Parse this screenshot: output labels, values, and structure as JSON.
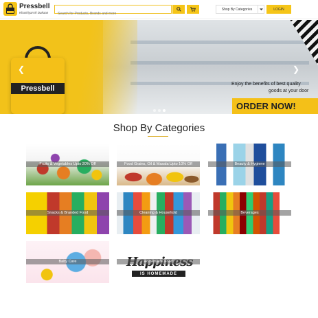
{
  "header": {
    "brand": "Pressbell",
    "tagline": "Khushiyan ki Dukaan",
    "search_placeholder": "Search for Products, Brands and more",
    "category_select": "Shop By Categories",
    "login_label": "LOGIN"
  },
  "banner": {
    "bag_label": "Pressbell",
    "tagline_line1": "Enjoy the benefits of best quality",
    "tagline_line2": "goods at your door",
    "order_label": "ORDER NOW!"
  },
  "section": {
    "title": "Shop By Categories"
  },
  "categories": [
    {
      "label": "Fruits & Vegetables Upto 20% Off"
    },
    {
      "label": "Food Grains, Oil & Masala Upto 10% Off"
    },
    {
      "label": "Beauty & Hygiene"
    },
    {
      "label": "Snacks & Branded Food"
    },
    {
      "label": "Cleaning & Household"
    },
    {
      "label": "Beverages"
    },
    {
      "label": "Baby Care"
    },
    {
      "label": "Homemade Food"
    }
  ],
  "happiness": {
    "main": "Happiness",
    "sub": "IS HOMEMADE"
  },
  "colors": {
    "accent": "#f5c518"
  }
}
